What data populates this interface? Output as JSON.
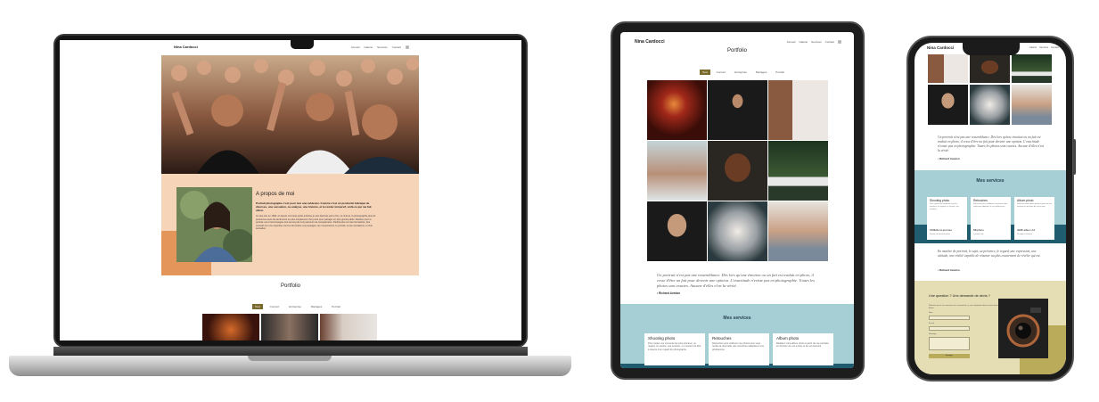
{
  "site": {
    "brand": "Nina Cardocci",
    "nav": [
      "Accueil",
      "Galerie",
      "Services",
      "Contact"
    ]
  },
  "laptop": {
    "about": {
      "title": "A propos de moi",
      "lead": "Portrait photographe c'est pour moi une évidence. Comme c'est un productin fabriqué de diverses, une sensation, ou analyse, une histoire, et le render immersif, voilà ce qui me fait vibrer.",
      "body": "Je suis née en 1994, et depuis ma toute petite enfance je suis fascinée par le film, le cinéma, la photographie plus de personnes avec de sentiments en plus simplement d'un point pour partager en plus grand public. Passion pour le portrait, qui m'accompagne tout au long de mon parcours de compétences. Parfois plus sur des formations, des conseils sur une expertise comme la lumière, les paysages, les mouvements, le portrait, ou les sensations, et d'un sensation."
    },
    "portfolio_title": "Portfolio",
    "filters": [
      "Tout",
      "Concert",
      "Entreprise",
      "Mariages",
      "Portrait"
    ],
    "active_filter": "Tout"
  },
  "tablet": {
    "title": "Portfolio",
    "filters": [
      "Tout",
      "Concert",
      "Entreprise",
      "Mariages",
      "Portrait"
    ],
    "active_filter": "Tout",
    "quote": "Un portrait n'est pas une ressemblance. Dès lors qu'une émotion ou un fait est traduit en photo, il cesse d'être un fait pour devenir une opinion. L'exactitude n'existe pas en photographie. Toutes les photos sont exactes. Aucune d'elles n'est la vérité.",
    "author": "• Richard Avedon",
    "services_title": "Mes services",
    "services": [
      {
        "name": "Shooting photo",
        "desc": "Pour capter vos moments les plus précieux, un regard, un sourire, une émotion, un moment de fête à travers mon regard de photographe."
      },
      {
        "name": "Retouches",
        "desc": "Retouches pour sublimer vos photos pour vous rendre la plus belle, des retouches adaptées à vos préférences."
      },
      {
        "name": "Album photo",
        "desc": "Réalisez votre album photo à partir de vos portraits en fonction de vos envies et de vos besoins."
      }
    ]
  },
  "phone": {
    "quote1": "Un portrait n'est pas une ressemblance. Dès lors qu'une émotion ou un fait est traduit en photo, il cesse d'être un fait pour devenir une opinion. L'exactitude n'existe pas en photographie. Toutes les photos sont exactes. Aucune d'elles n'est la vérité.",
    "author1": "• Richard Avedon",
    "services_title": "Mes services",
    "services": [
      {
        "name": "Shooting photo",
        "desc": "Pour capter vos moments les plus précieux, un regard, un sourire, une émotion.",
        "price": "150€/demi-journée",
        "note": "Dossier de livraison inclus"
      },
      {
        "name": "Retouches",
        "desc": "Retouches pour sublimer vos photos, des retouches adaptées à vos préférences.",
        "price": "5€/photo",
        "note": "5 photos min"
      },
      {
        "name": "Album photo",
        "desc": "Réalisez votre album photo à partir de vos portraits en fonction de vos envies.",
        "price": "400€ album A4",
        "note": "30 pages minimum"
      }
    ],
    "quote2": "En matière de portrait, le sujet, sa présence, le regard, une expression, une attitude, une réalité capable de résumer au plus exactement de révéler qui est.",
    "author2": "• Richard Avedon",
    "contact": {
      "title": "Une question ? Une demande de devis ?",
      "subtitle": "N'hésitez pas à me contacter via ce formulaire, je vous répondrai dans les plus brefs délais.",
      "labels": [
        "Nom",
        "E-mail",
        "Message"
      ],
      "submit": "Envoyer"
    }
  },
  "colors": {
    "about_bg": "#f6d4b8",
    "about_accent": "#e4965a",
    "filter_active": "#7a6a2b",
    "services_bg": "#a6cfd5",
    "services_band": "#1f5c70",
    "contact_bg": "#e5ddb4",
    "contact_accent": "#b9ab5a"
  }
}
